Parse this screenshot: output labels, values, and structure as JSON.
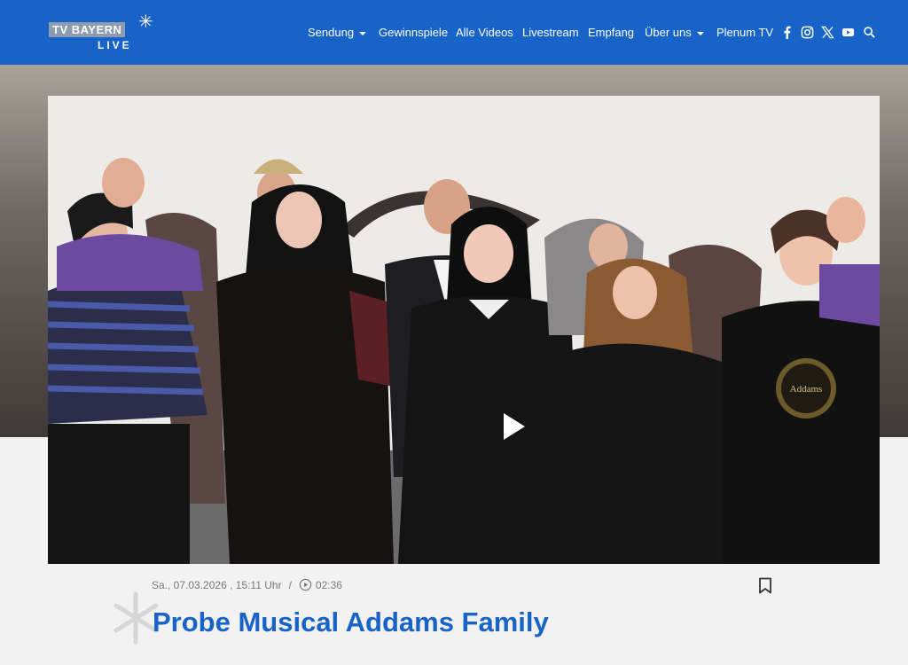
{
  "brand": {
    "logo_text": "TV BAYERN",
    "logo_sub": "LIVE",
    "logo_star": "✳"
  },
  "nav": {
    "items": [
      {
        "label": "Sendung",
        "dropdown": true
      },
      {
        "label": "Gewinnspiele",
        "dropdown": false
      },
      {
        "label": "Alle Videos",
        "dropdown": false
      },
      {
        "label": "Livestream",
        "dropdown": false
      },
      {
        "label": "Empfang",
        "dropdown": false
      },
      {
        "label": "Über uns",
        "dropdown": true
      },
      {
        "label": "Plenum TV",
        "dropdown": false
      }
    ],
    "social": [
      "facebook-icon",
      "instagram-icon",
      "x-icon",
      "youtube-icon",
      "search-icon"
    ]
  },
  "video": {
    "play_icon": "play-icon"
  },
  "article": {
    "date": "Sa., 07.03.2026 , 15:11 Uhr",
    "separator": "/",
    "duration": "02:36",
    "title": "Probe Musical Addams Family"
  },
  "colors": {
    "brand_blue": "#1763c7",
    "page_bg": "#f2f2f2",
    "meta_gray": "#7a7a7a"
  }
}
